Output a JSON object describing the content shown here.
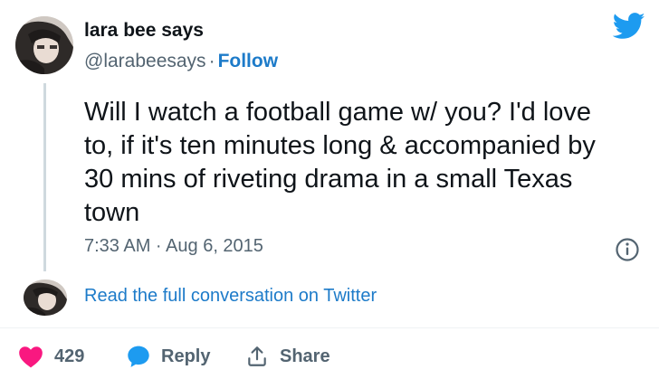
{
  "author": {
    "name": "lara bee says",
    "handle": "@larabeesays",
    "separator": "·",
    "follow_label": "Follow"
  },
  "tweet": {
    "text": "Will I watch a football game w/ you? I'd love to, if it's ten minutes long & accompanied by 30 mins of riveting drama in a small Texas town",
    "timestamp": "7:33 AM · Aug 6, 2015"
  },
  "thread": {
    "read_more_label": "Read the full conversation on Twitter"
  },
  "actions": {
    "like_count": "429",
    "reply_label": "Reply",
    "share_label": "Share"
  },
  "icons": {
    "logo": "twitter-bird-icon",
    "info": "info-icon",
    "like": "heart-icon",
    "reply": "speech-bubble-icon",
    "share": "share-upload-icon"
  },
  "colors": {
    "accent": "#1d9bf0",
    "link": "#1d7bc9",
    "like": "#f91880",
    "muted": "#536471",
    "text": "#0f1419"
  }
}
